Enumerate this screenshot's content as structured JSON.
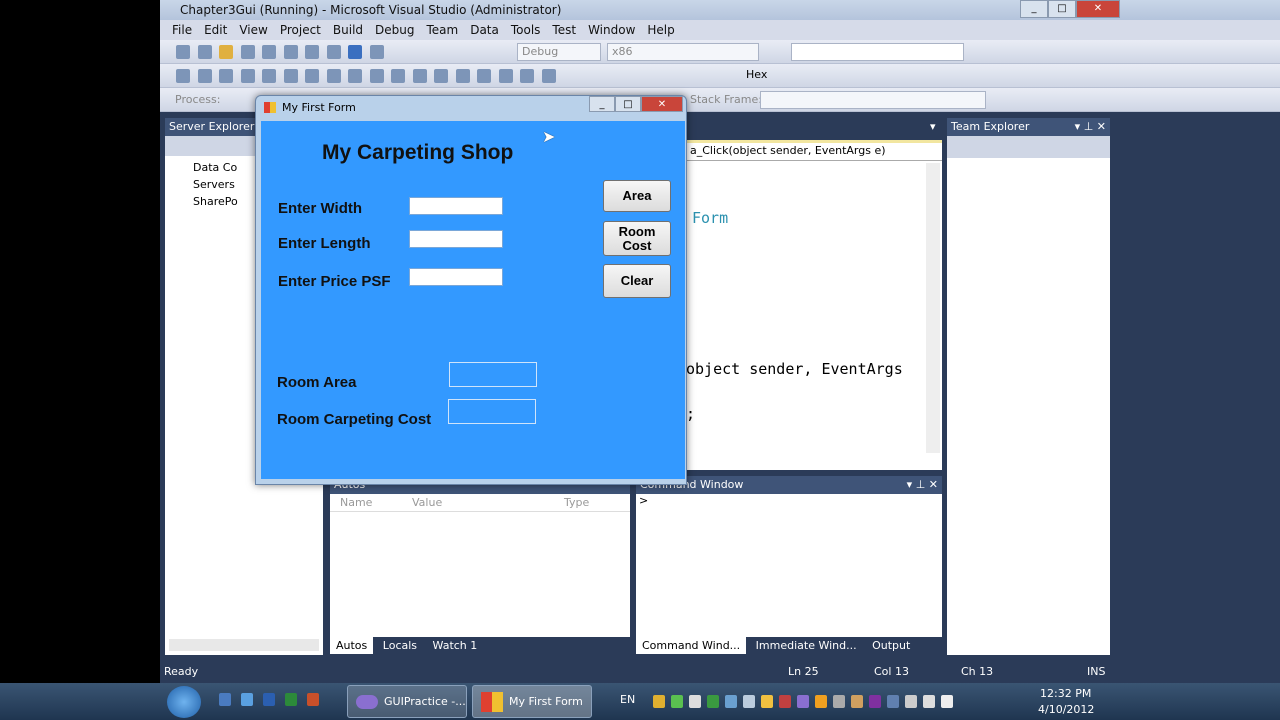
{
  "window": {
    "title": "Chapter3Gui (Running) - Microsoft Visual Studio (Administrator)"
  },
  "menu": [
    "File",
    "Edit",
    "View",
    "Project",
    "Build",
    "Debug",
    "Team",
    "Data",
    "Tools",
    "Test",
    "Window",
    "Help"
  ],
  "toolbar": {
    "config": "Debug",
    "platform": "x86",
    "hex_label": "Hex",
    "process_label": "Process:",
    "stack_frame_label": "Stack Frame:"
  },
  "server_explorer": {
    "title": "Server Explorer",
    "items": [
      "Data Co",
      "Servers",
      "SharePo"
    ]
  },
  "editor": {
    "method_dropdown": "a_Click(object sender, EventArgs e)",
    "code_lines": [
      "Form",
      "object sender, EventArgs",
      ";"
    ]
  },
  "team_explorer": {
    "title": "Team Explorer"
  },
  "autos": {
    "title": "Autos",
    "columns": [
      "Name",
      "Value",
      "Type"
    ],
    "tabs": [
      "Autos",
      "Locals",
      "Watch 1"
    ]
  },
  "command": {
    "title": "Command Window",
    "prompt": ">",
    "tabs": [
      "Command Wind...",
      "Immediate Wind...",
      "Output"
    ]
  },
  "status": {
    "ready": "Ready",
    "ln": "Ln 25",
    "col": "Col 13",
    "ch": "Ch 13",
    "mode": "INS"
  },
  "form": {
    "title": "My First Form",
    "heading": "My Carpeting Shop",
    "labels": {
      "width": "Enter Width",
      "length": "Enter Length",
      "price": "Enter Price PSF",
      "area": "Room Area",
      "cost": "Room Carpeting Cost"
    },
    "inputs": {
      "width": "",
      "length": "",
      "price": "",
      "area": "",
      "cost": ""
    },
    "buttons": {
      "area": "Area",
      "room_cost": "Room Cost",
      "clear": "Clear"
    },
    "back_color": "#3399ff"
  },
  "taskbar": {
    "items": [
      "GUIPractice -...",
      "My First Form"
    ],
    "lang": "EN",
    "time": "12:32 PM",
    "date": "4/10/2012"
  }
}
